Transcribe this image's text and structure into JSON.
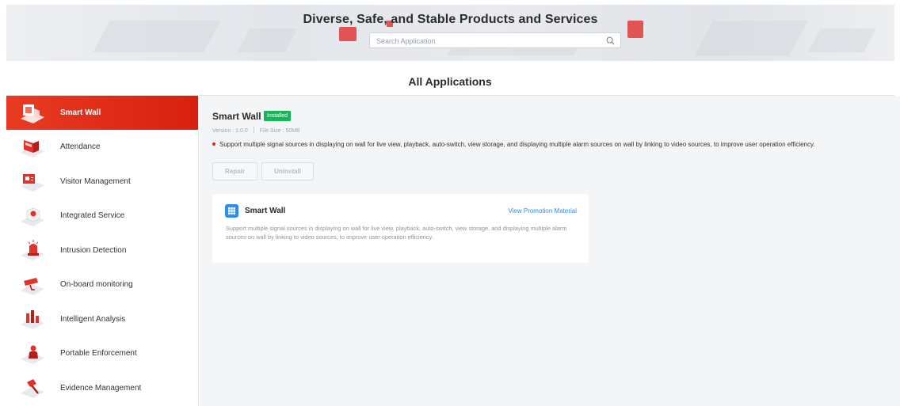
{
  "banner": {
    "title": "Diverse, Safe, and Stable Products and Services",
    "search_placeholder": "Search Application",
    "search_value": ""
  },
  "page_title": "All Applications",
  "sidebar": {
    "items": [
      {
        "label": "Smart Wall",
        "icon": "smart-wall-icon",
        "active": true
      },
      {
        "label": "Attendance",
        "icon": "attendance-icon"
      },
      {
        "label": "Visitor Management",
        "icon": "visitor-management-icon"
      },
      {
        "label": "Integrated Service",
        "icon": "integrated-service-icon"
      },
      {
        "label": "Intrusion Detection",
        "icon": "intrusion-detection-icon"
      },
      {
        "label": "On-board monitoring",
        "icon": "on-board-monitoring-icon"
      },
      {
        "label": "Intelligent Analysis",
        "icon": "intelligent-analysis-icon"
      },
      {
        "label": "Portable Enforcement",
        "icon": "portable-enforcement-icon"
      },
      {
        "label": "Evidence Management",
        "icon": "evidence-management-icon"
      }
    ]
  },
  "detail": {
    "name": "Smart Wall",
    "status": "Installed",
    "version": "Version : 1.0.0",
    "file_size": "File Size : 50MB",
    "description": "Support multiple signal sources in displaying on wall for live view, playback, auto-switch, view storage, and displaying multiple alarm sources on wall by linking to video sources, to improve user operation efficiency.",
    "repair_label": "Repair",
    "uninstall_label": "Uninstall"
  },
  "promo": {
    "title": "Smart Wall",
    "link": "View Promotion Material",
    "text": "Support multiple signal sources in displaying on wall for live view, playback, auto-switch, view storage, and displaying multiple alarm sources on wall by linking to video sources, to improve user operation efficiency."
  },
  "colors": {
    "accent_red": "#e3261a",
    "installed_green": "#1bb35a",
    "link_blue": "#2f8cf0"
  }
}
